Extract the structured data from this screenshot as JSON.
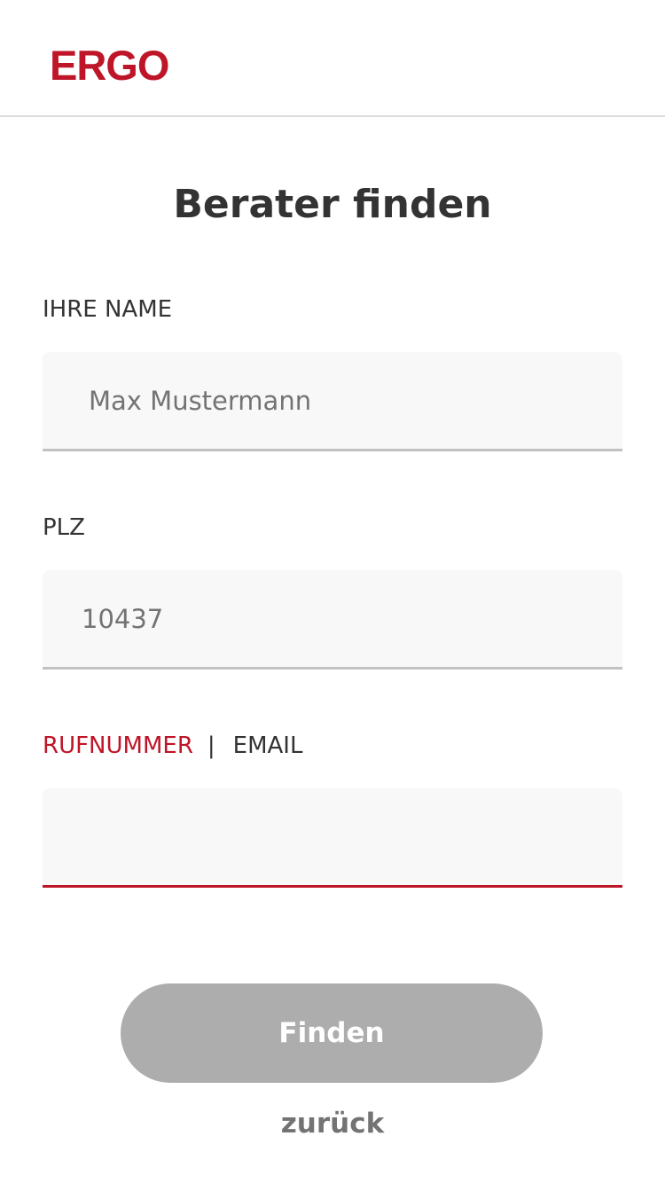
{
  "header": {
    "logo_text": "ERGO"
  },
  "page": {
    "title": "Berater finden"
  },
  "form": {
    "name": {
      "label": "IHRE NAME",
      "placeholder": "Max Mustermann",
      "value": ""
    },
    "plz": {
      "label": "PLZ",
      "placeholder": "10437",
      "value": ""
    },
    "contact": {
      "option_phone": "RUFNUMMER",
      "separator": "|",
      "option_email": "EMAIL",
      "placeholder": "",
      "value": ""
    }
  },
  "actions": {
    "submit_label": "Finden",
    "back_label": "zurück"
  },
  "colors": {
    "brand_red": "#bf1528",
    "button_disabled": "#adadad",
    "field_background": "#f8f8f8",
    "text_dark": "#333333",
    "text_muted": "#737373"
  }
}
